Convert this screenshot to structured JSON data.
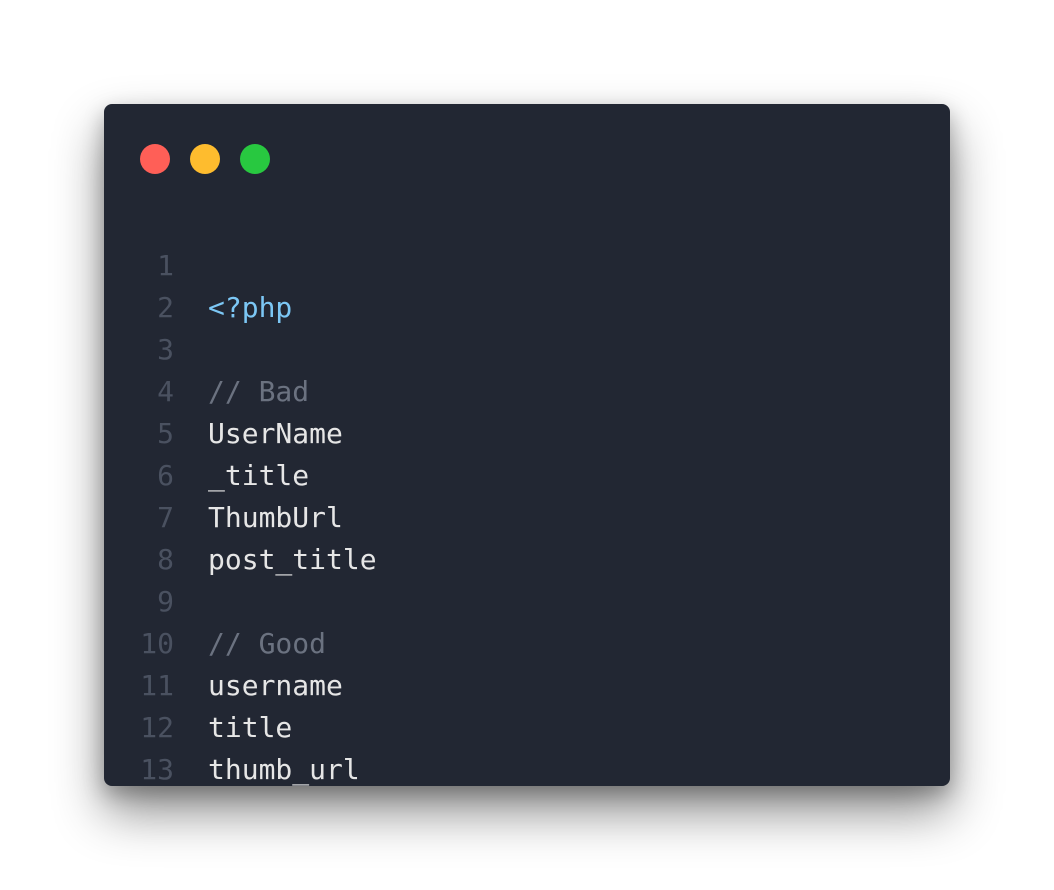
{
  "window": {
    "controls": [
      {
        "name": "close",
        "color": "#ff5f57"
      },
      {
        "name": "minimize",
        "color": "#febc2e"
      },
      {
        "name": "maximize",
        "color": "#28c840"
      }
    ]
  },
  "colors": {
    "background": "#222733",
    "line_number": "#4a5160",
    "comment": "#6b7280",
    "php_tag": "#7cc7f5",
    "plain": "#e6e6e6"
  },
  "code": {
    "lines": [
      {
        "number": "1",
        "text": "<?php",
        "kind": "php_tag"
      },
      {
        "number": "2",
        "text": "",
        "kind": "plain"
      },
      {
        "number": "3",
        "text": "// Bad",
        "kind": "comment"
      },
      {
        "number": "4",
        "text": "UserName",
        "kind": "plain"
      },
      {
        "number": "5",
        "text": "_title",
        "kind": "plain"
      },
      {
        "number": "6",
        "text": "ThumbUrl",
        "kind": "plain"
      },
      {
        "number": "7",
        "text": "post_title",
        "kind": "plain"
      },
      {
        "number": "8",
        "text": "",
        "kind": "plain"
      },
      {
        "number": "9",
        "text": "// Good",
        "kind": "comment"
      },
      {
        "number": "10",
        "text": "username",
        "kind": "plain"
      },
      {
        "number": "11",
        "text": "title",
        "kind": "plain"
      },
      {
        "number": "12",
        "text": "thumb_url",
        "kind": "plain"
      },
      {
        "number": "13",
        "text": "",
        "kind": "plain"
      }
    ]
  }
}
